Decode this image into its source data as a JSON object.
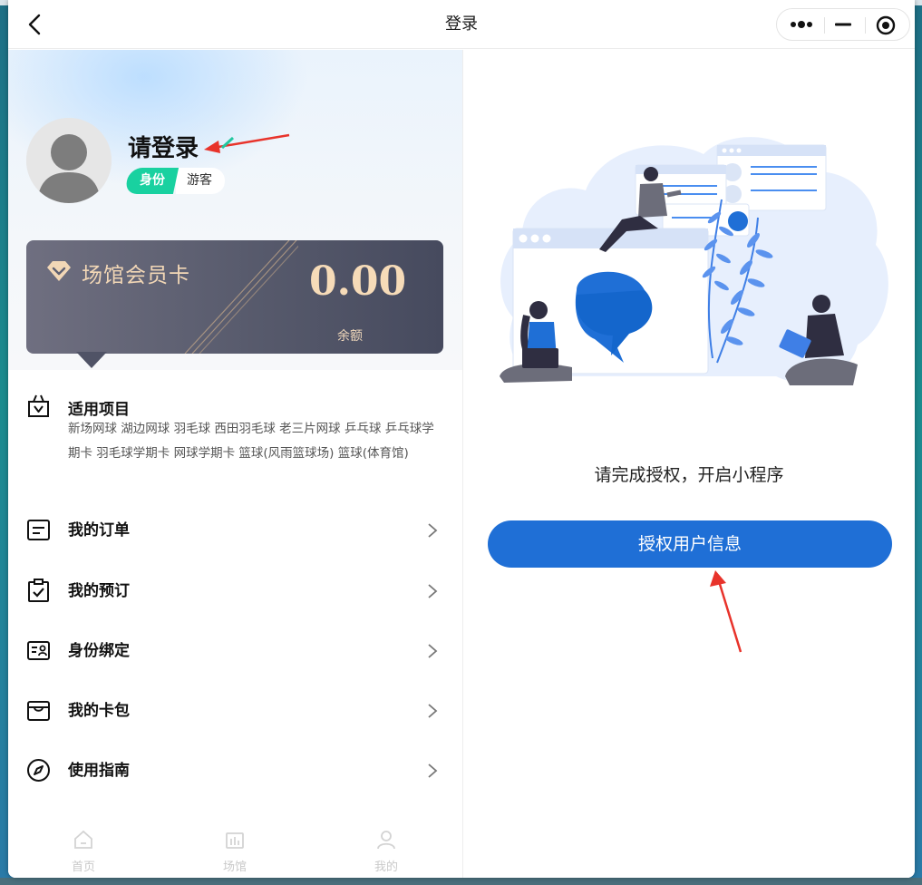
{
  "window": {
    "title": "登录",
    "icons": {
      "back": "chevron-left-icon",
      "more": "more-dots-icon",
      "minimize": "minimize-icon",
      "close": "target-close-icon"
    }
  },
  "profile": {
    "login_prompt": "请登录",
    "identity_key": "身份",
    "identity_value": "游客"
  },
  "member_card": {
    "title": "场馆会员卡",
    "balance": "0.00",
    "balance_label": "余额",
    "colors": {
      "gold": "#f6dbb8",
      "card_bg": "#575a6c"
    }
  },
  "projects": {
    "title": "适用项目",
    "list": "新场网球  湖边网球  羽毛球  西田羽毛球  老三片网球  乒乓球  乒乓球学期卡  羽毛球学期卡  网球学期卡  篮球(风雨篮球场)  篮球(体育馆)"
  },
  "menu": [
    {
      "label": "我的订单",
      "icon": "order-list-icon"
    },
    {
      "label": "我的预订",
      "icon": "clipboard-check-icon"
    },
    {
      "label": "身份绑定",
      "icon": "id-card-icon"
    },
    {
      "label": "我的卡包",
      "icon": "wallet-icon"
    },
    {
      "label": "使用指南",
      "icon": "compass-icon"
    }
  ],
  "tabbar": [
    {
      "label": "首页",
      "icon": "home-icon"
    },
    {
      "label": "场馆",
      "icon": "venue-icon"
    },
    {
      "label": "我的",
      "icon": "user-icon"
    }
  ],
  "auth": {
    "prompt": "请完成授权，开启小程序",
    "button": "授权用户信息",
    "colors": {
      "button": "#1f6fd6"
    }
  },
  "accent_colors": {
    "identity_tag": "#19d1a0",
    "annotation_arrow": "#e8332b"
  }
}
